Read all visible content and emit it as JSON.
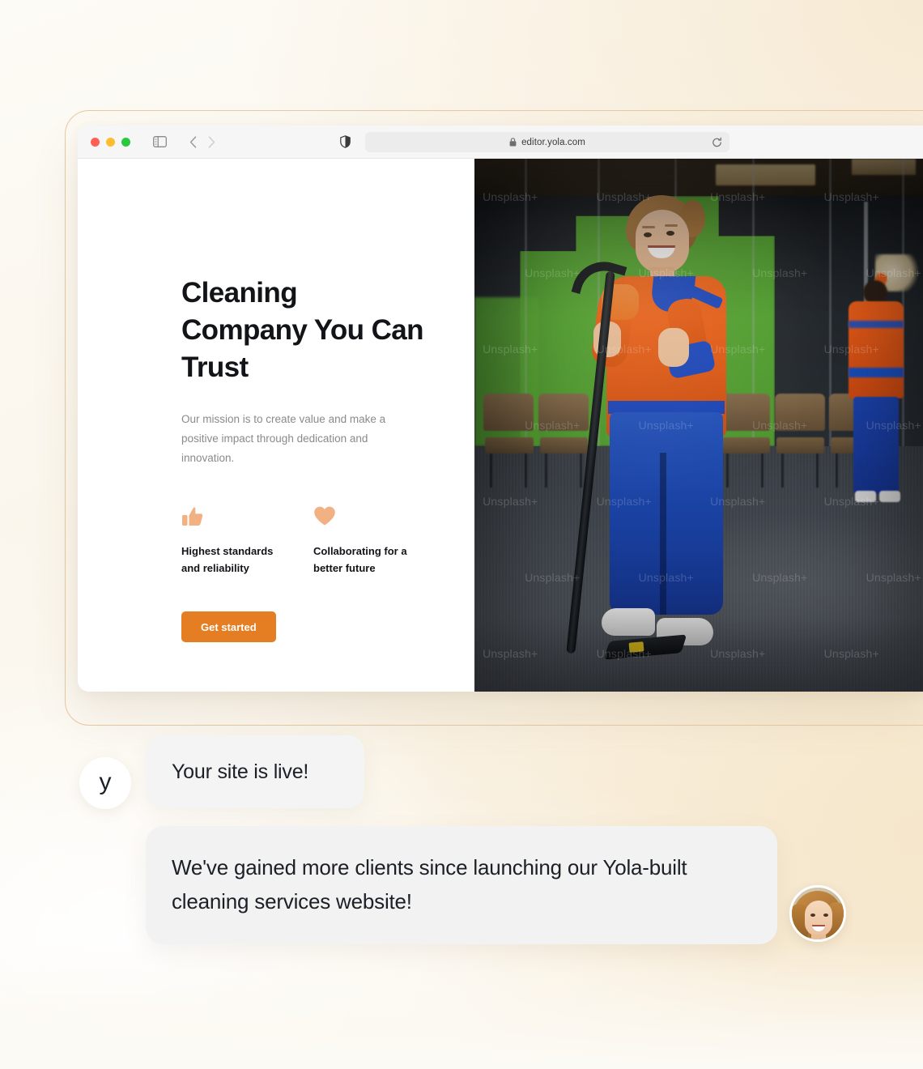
{
  "browser": {
    "url": "editor.yola.com",
    "traffic_lights": [
      {
        "name": "close",
        "color": "#FF5F57"
      },
      {
        "name": "minimize",
        "color": "#FEBC2E"
      },
      {
        "name": "maximize",
        "color": "#28C840"
      }
    ],
    "icons": {
      "sidebar": "sidebar-toggle-icon",
      "back": "back-chevron-icon",
      "forward": "forward-chevron-icon",
      "shield": "privacy-shield-icon",
      "lock": "lock-icon",
      "refresh": "refresh-icon"
    }
  },
  "hero": {
    "heading": "Cleaning Company You Can Trust",
    "subheading": "Our mission is to create value and make a positive impact through dedication and innovation.",
    "features": [
      {
        "icon": "thumbs-up-icon",
        "label": "Highest standards and reliability"
      },
      {
        "icon": "heart-icon",
        "label": "Collaborating for a better future"
      }
    ],
    "cta_label": "Get started",
    "image_watermark": "Unsplash+"
  },
  "chat": {
    "brand_avatar_glyph": "y",
    "status_message": "Your site is live!",
    "testimonial": "We've gained more clients since launching our Yola-built cleaning services website!"
  },
  "colors": {
    "cta_orange": "#E57E22",
    "feature_icon_peach": "#F2B183",
    "heading_dark": "#121418",
    "body_gray": "#8A8A8E",
    "frame_tan": "#E8C9A3",
    "page_bg": "#FBF6EC"
  }
}
